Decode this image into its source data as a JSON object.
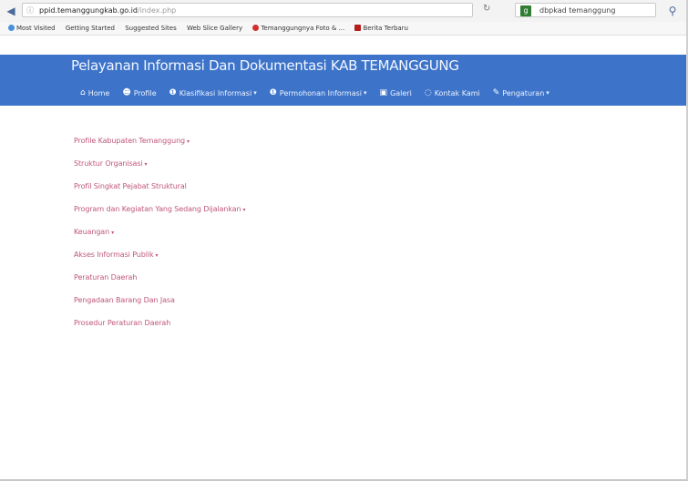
{
  "browser": {
    "url_host": "ppid.temanggungkab.go.id",
    "url_path": "/index.php",
    "search_text": "dbpkad temanggung",
    "bookmarks": [
      {
        "label": "Most Visited",
        "color": "#4a90d9"
      },
      {
        "label": "Getting Started",
        "color": ""
      },
      {
        "label": "Suggested Sites",
        "color": ""
      },
      {
        "label": "Web Slice Gallery",
        "color": ""
      },
      {
        "label": "Temanggungnya Foto & ...",
        "color": "#d32f2f"
      },
      {
        "label": "Berita Terbaru",
        "color": "#b71c1c"
      }
    ]
  },
  "site": {
    "title": "Pelayanan Informasi Dan Dokumentasi KAB TEMANGGUNG",
    "header_color": "#3d74c9",
    "menu": [
      {
        "label": "Home",
        "icon": "home-icon",
        "glyph": "⌂",
        "dropdown": false
      },
      {
        "label": "Profile",
        "icon": "user-icon",
        "glyph": "☻",
        "dropdown": false
      },
      {
        "label": "Klasifikasi Informasi",
        "icon": "info-icon",
        "glyph": "❶",
        "dropdown": true
      },
      {
        "label": "Permohonan Informasi",
        "icon": "info-icon",
        "glyph": "❶",
        "dropdown": true
      },
      {
        "label": "Galeri",
        "icon": "image-icon",
        "glyph": "▣",
        "dropdown": false
      },
      {
        "label": "Kontak Kami",
        "icon": "globe-icon",
        "glyph": "◌",
        "dropdown": false
      },
      {
        "label": "Pengaturan",
        "icon": "pencil-icon",
        "glyph": "✎",
        "dropdown": true
      }
    ]
  },
  "main": {
    "links": [
      {
        "label": "Profile Kabupaten Temanggung",
        "dropdown": true
      },
      {
        "label": "Struktur Organisasi",
        "dropdown": true
      },
      {
        "label": "Profil Singkat Pejabat Struktural",
        "dropdown": false
      },
      {
        "label": "Program dan Kegiatan Yang Sedang Dijalankan",
        "dropdown": true
      },
      {
        "label": "Keuangan",
        "dropdown": true
      },
      {
        "label": "Akses Informasi Publik",
        "dropdown": true
      },
      {
        "label": "Peraturan Daerah",
        "dropdown": false
      },
      {
        "label": "Pengadaan Barang Dan Jasa",
        "dropdown": false
      },
      {
        "label": "Prosedur Peraturan Daerah",
        "dropdown": false
      }
    ]
  }
}
